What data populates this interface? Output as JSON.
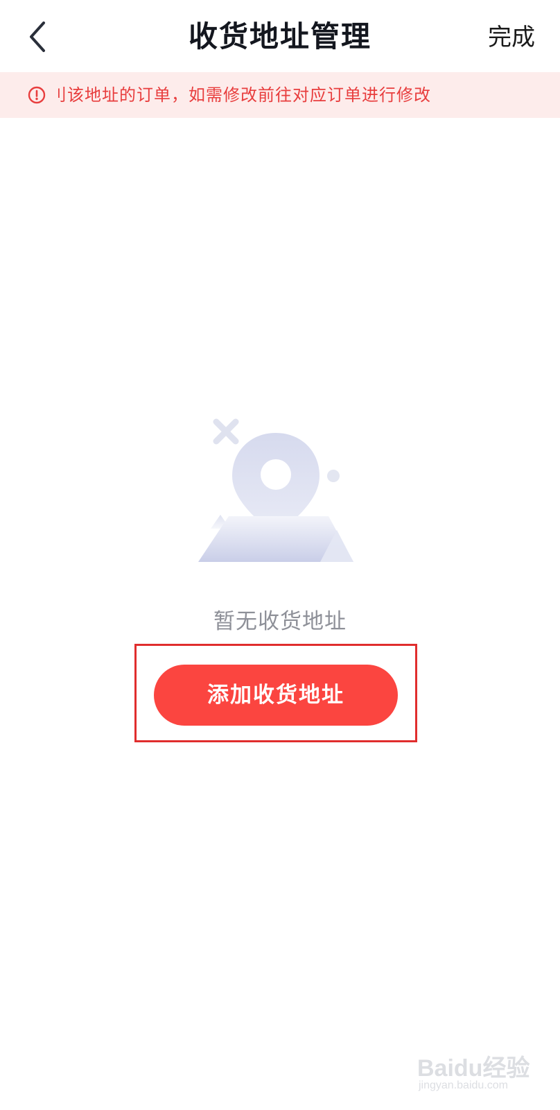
{
  "header": {
    "title": "收货地址管理",
    "done_label": "完成",
    "back_icon": "chevron-left-icon"
  },
  "notice": {
    "icon": "info-circle-icon",
    "text": "刂该地址的订单，如需修改前往对应订单进行修改",
    "text_color": "#e83d3d",
    "background": "#fdeceb"
  },
  "empty_state": {
    "illustration": "map-pin-empty-illustration",
    "message": "暂无收货地址"
  },
  "actions": {
    "add_address_label": "添加收货地址",
    "button_color": "#fb4540"
  },
  "watermark": {
    "main_text": "Baidu经验",
    "sub_text": "jingyan.baidu.com"
  }
}
